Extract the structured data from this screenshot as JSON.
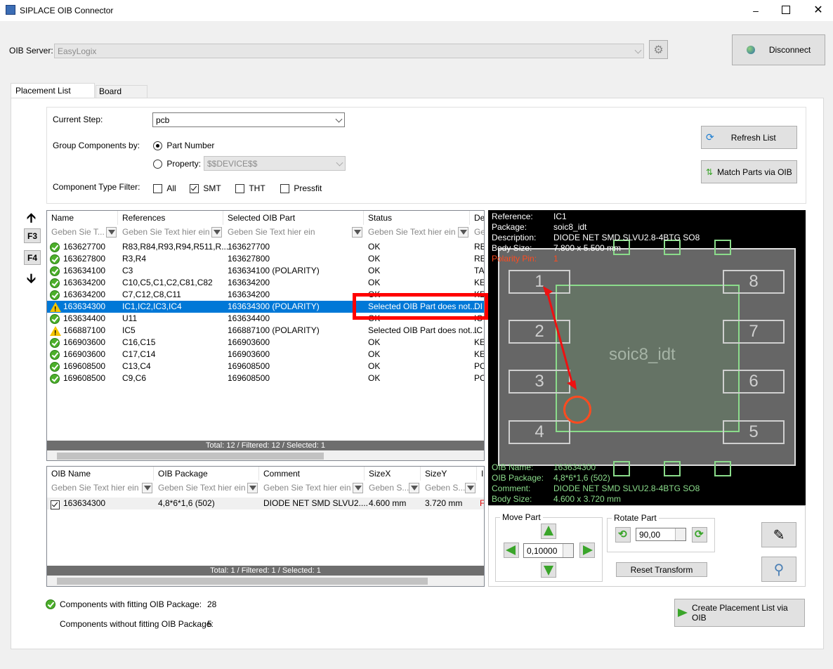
{
  "window": {
    "title": "SIPLACE OIB Connector"
  },
  "server": {
    "label": "OIB Server:",
    "value": "EasyLogix",
    "disconnect_label": "Disconnect"
  },
  "tabs": [
    {
      "label": "Placement List Creator"
    },
    {
      "label": "Board Creator"
    }
  ],
  "settings": {
    "current_step_label": "Current Step:",
    "current_step_value": "pcb",
    "group_label": "Group Components by:",
    "part_number_label": "Part Number",
    "property_label": "Property:",
    "property_value": "$$DEVICE$$",
    "type_filter_label": "Component Type Filter:",
    "filter_all": "All",
    "filter_smt": "SMT",
    "filter_tht": "THT",
    "filter_pressfit": "Pressfit",
    "refresh_label": "Refresh List",
    "match_label": "Match Parts via OIB"
  },
  "nav": {
    "f3": "F3",
    "f4": "F4"
  },
  "components_table": {
    "columns": [
      "Name",
      "References",
      "Selected OIB Part",
      "Status",
      "De"
    ],
    "filters": [
      "Geben Sie T...",
      "Geben Sie Text hier ein",
      "Geben Sie Text hier ein",
      "Geben Sie Text hier ein",
      "Ge"
    ],
    "rows": [
      {
        "name": "163627700",
        "refs": "R83,R84,R93,R94,R511,R...",
        "part": "163627700",
        "status": "OK",
        "de": "RE"
      },
      {
        "name": "163627800",
        "refs": "R3,R4",
        "part": "163627800",
        "status": "OK",
        "de": "RE"
      },
      {
        "name": "163634100",
        "refs": "C3",
        "part": "163634100 (POLARITY)",
        "status": "OK",
        "de": "TA"
      },
      {
        "name": "163634200",
        "refs": "C10,C5,C1,C2,C81,C82",
        "part": "163634200",
        "status": "OK",
        "de": "KE"
      },
      {
        "name": "163634200",
        "refs": "C7,C12,C8,C11",
        "part": "163634200",
        "status": "OK",
        "de": "KE"
      },
      {
        "name": "163634300",
        "refs": "IC1,IC2,IC3,IC4",
        "part": "163634300 (POLARITY)",
        "status": "Selected OIB Part does not...",
        "de": "DI"
      },
      {
        "name": "163634400",
        "refs": "U11",
        "part": "163634400",
        "status": "OK",
        "de": "IC"
      },
      {
        "name": "166887100",
        "refs": "IC5",
        "part": "166887100 (POLARITY)",
        "status": "Selected OIB Part does not...",
        "de": "IC"
      },
      {
        "name": "166903600",
        "refs": "C16,C15",
        "part": "166903600",
        "status": "OK",
        "de": "KE"
      },
      {
        "name": "166903600",
        "refs": "C17,C14",
        "part": "166903600",
        "status": "OK",
        "de": "KE"
      },
      {
        "name": "169608500",
        "refs": "C13,C4",
        "part": "169608500",
        "status": "OK",
        "de": "PC"
      },
      {
        "name": "169608500",
        "refs": "C9,C6",
        "part": "169608500",
        "status": "OK",
        "de": "PC"
      }
    ],
    "footer": "Total: 12 / Filtered: 12 / Selected: 1"
  },
  "oib_table": {
    "columns": [
      "OIB Name",
      "OIB Package",
      "Comment",
      "SizeX",
      "SizeY",
      "I"
    ],
    "filters": [
      "Geben Sie Text hier ein",
      "Geben Sie Text hier ein",
      "Geben Sie Text hier ein",
      "Geben S...",
      "Geben S..."
    ],
    "rows": [
      {
        "name": "163634300",
        "package": "4,8*6*1,6 (502)",
        "comment": "DIODE NET SMD SLVU2....",
        "sizex": "4.600 mm",
        "sizey": "3.720 mm",
        "i": "F"
      }
    ],
    "footer": "Total: 1 / Filtered: 1 / Selected: 1"
  },
  "preview": {
    "reference_label": "Reference:",
    "reference": "IC1",
    "package_label": "Package:",
    "package": "soic8_idt",
    "description_label": "Description:",
    "description": "DIODE NET SMD SLVU2.8-4BTG SO8",
    "body_label": "Body Size:",
    "body": "7.800 x 5.500 mm",
    "polarity_label": "Polarity Pin:",
    "polarity": "1",
    "center_label": "soic8_idt",
    "pins": [
      "1",
      "2",
      "3",
      "4",
      "5",
      "6",
      "7",
      "8"
    ],
    "oib_name_label": "OIB Name:",
    "oib_name": "163634300",
    "oib_package_label": "OIB Package:",
    "oib_package": "4,8*6*1,6 (502)",
    "comment_label": "Comment:",
    "comment": "DIODE NET SMD SLVU2.8-4BTG SO8",
    "oib_body_label": "Body Size:",
    "oib_body": "4.600 x 3.720 mm"
  },
  "controls": {
    "move_label": "Move Part",
    "move_value": "0,10000",
    "rotate_label": "Rotate Part",
    "rotate_value": "90,00",
    "reset_label": "Reset Transform"
  },
  "summary": {
    "fitting_label": "Components with fitting OIB Package:",
    "fitting_count": "28",
    "without_label": "Components without fitting OIB Package:",
    "without_count": "5"
  },
  "create_label": "Create Placement List via OIB",
  "colors": {
    "accent": "#0078d7",
    "highlight": "#ff0000",
    "pad_green": "#8bdc8b",
    "polarity": "#ff4b1f"
  }
}
